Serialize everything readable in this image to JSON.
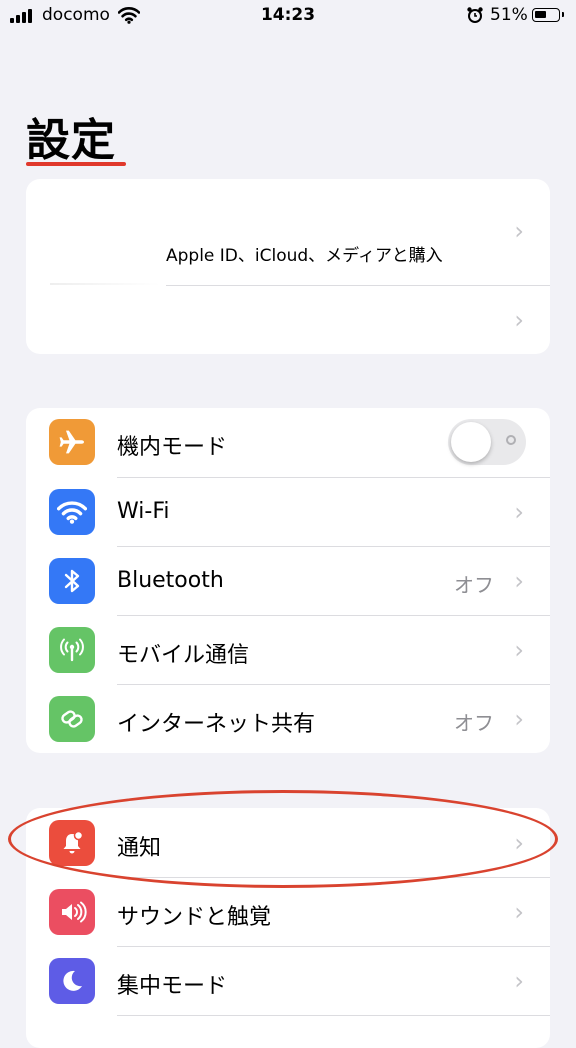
{
  "status_bar": {
    "carrier": "docomo",
    "time": "14:23",
    "battery": "51%"
  },
  "page_title": "設定",
  "profile": {
    "apple_id_label": "Apple ID、iCloud、メディアと購入"
  },
  "connectivity": [
    {
      "label": "機内モード",
      "icon": "airplane-icon",
      "color": "#f09a37",
      "toggle": false
    },
    {
      "label": "Wi-Fi",
      "icon": "wifi-icon",
      "color": "#3478f6"
    },
    {
      "label": "Bluetooth",
      "icon": "bluetooth-icon",
      "color": "#3478f6",
      "value": "オフ"
    },
    {
      "label": "モバイル通信",
      "icon": "antenna-icon",
      "color": "#65c466"
    },
    {
      "label": "インターネット共有",
      "icon": "link-icon",
      "color": "#65c466",
      "value": "オフ"
    }
  ],
  "notifications_group": [
    {
      "label": "通知",
      "icon": "bell-badge-icon",
      "color": "#eb4d3d"
    },
    {
      "label": "サウンドと触覚",
      "icon": "speaker-icon",
      "color": "#eb4e61"
    },
    {
      "label": "集中モード",
      "icon": "moon-icon",
      "color": "#5e5ce6"
    }
  ]
}
